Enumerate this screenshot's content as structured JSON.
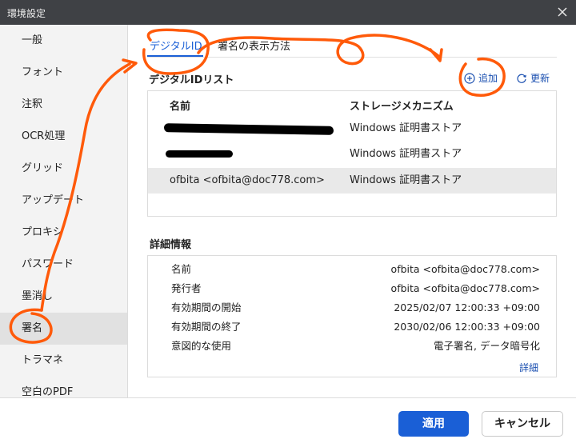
{
  "window": {
    "title": "環境設定"
  },
  "sidebar": {
    "items": [
      {
        "label": "一般"
      },
      {
        "label": "フォント"
      },
      {
        "label": "注釈"
      },
      {
        "label": "OCR処理"
      },
      {
        "label": "グリッド"
      },
      {
        "label": "アップデート"
      },
      {
        "label": "プロキシ"
      },
      {
        "label": "パスワード"
      },
      {
        "label": "墨消し"
      },
      {
        "label": "署名",
        "active": true
      },
      {
        "label": "トラマネ"
      },
      {
        "label": "空白のPDF"
      }
    ]
  },
  "tabs": [
    {
      "label": "デジタルID",
      "active": true
    },
    {
      "label": "署名の表示方法"
    }
  ],
  "digital_ids": {
    "title": "デジタルIDリスト",
    "add_label": "追加",
    "refresh_label": "更新",
    "columns": [
      "名前",
      "ストレージメカニズム"
    ],
    "rows": [
      {
        "name": "",
        "storage": "Windows 証明書ストア",
        "redacted": true
      },
      {
        "name": "",
        "storage": "Windows 証明書ストア",
        "redacted": true
      },
      {
        "name": "ofbita <ofbita@doc778.com>",
        "storage": "Windows 証明書ストア",
        "selected": true
      }
    ]
  },
  "details": {
    "title": "詳細情報",
    "rows": [
      {
        "key": "名前",
        "value": "ofbita <ofbita@doc778.com>"
      },
      {
        "key": "発行者",
        "value": "ofbita <ofbita@doc778.com>"
      },
      {
        "key": "有効期間の開始",
        "value": "2025/02/07 12:00:33 +09:00"
      },
      {
        "key": "有効期間の終了",
        "value": "2030/02/06 12:00:33 +09:00"
      },
      {
        "key": "意図的な使用",
        "value": "電子署名, データ暗号化"
      }
    ],
    "more_label": "詳細"
  },
  "footer": {
    "apply_label": "適用",
    "cancel_label": "キャンセル"
  },
  "colors": {
    "accent": "#1a5fd6",
    "titlebar": "#3f4145",
    "annotation": "#ff5a0a"
  }
}
